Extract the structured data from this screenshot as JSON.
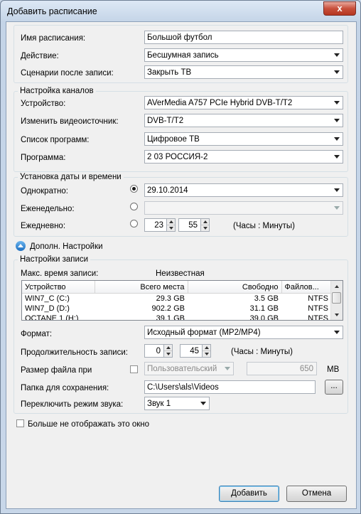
{
  "window": {
    "title": "Добавить расписание",
    "close_glyph": "x"
  },
  "schedule": {
    "name_label": "Имя расписания:",
    "name_value": "Большой футбол",
    "action_label": "Действие:",
    "action_value": "Бесшумная запись",
    "after_label": "Сценарии после записи:",
    "after_value": "Закрыть ТВ"
  },
  "channels": {
    "legend": "Настройка каналов",
    "device_label": "Устройство:",
    "device_value": "AVerMedia A757 PCIe Hybrid DVB-T/T2",
    "source_label": "Изменить видеоисточник:",
    "source_value": "DVB-T/T2",
    "list_label": "Список программ:",
    "list_value": "Цифровое ТВ",
    "program_label": "Программа:",
    "program_value": "2 03 РОССИЯ-2"
  },
  "datetime": {
    "legend": "Установка даты и времени",
    "once_label": "Однократно:",
    "once_value": "29.10.2014",
    "weekly_label": "Еженедельно:",
    "weekly_value": "",
    "daily_label": "Ежедневно:",
    "daily_hours": "23",
    "daily_minutes": "55",
    "time_hint": "(Часы : Минуты)"
  },
  "advanced": {
    "label": "Дополн. Настройки"
  },
  "recording": {
    "legend": "Настройки записи",
    "max_label": "Макс. время записи:",
    "max_value": "Неизвестная",
    "columns": [
      "Устройство",
      "Всего места",
      "Свободно",
      "Файлов..."
    ],
    "drives": [
      {
        "name": "WIN7_C (C:)",
        "total": "29.3 GB",
        "free": "3.5 GB",
        "fs": "NTFS"
      },
      {
        "name": "WIN7_D (D:)",
        "total": "902.2 GB",
        "free": "31.1 GB",
        "fs": "NTFS"
      },
      {
        "name": "OCTANE 1 (H:)",
        "total": "39.1 GB",
        "free": "39.0 GB",
        "fs": "NTFS"
      }
    ],
    "format_label": "Формат:",
    "format_value": "Исходный формат (MP2/MP4)",
    "duration_label": "Продолжительность записи:",
    "duration_hours": "0",
    "duration_minutes": "45",
    "duration_hint": "(Часы : Минуты)",
    "filesize_label": "Размер файла при",
    "filesize_mode": "Пользовательский",
    "filesize_value": "650",
    "filesize_unit": "MB",
    "folder_label": "Папка для сохранения:",
    "folder_value": "C:\\Users\\als\\Videos",
    "browse_label": "...",
    "sound_label": "Переключить режим звука:",
    "sound_value": "Звук 1"
  },
  "dont_show_label": "Больше не отображать это окно",
  "buttons": {
    "add": "Добавить",
    "cancel": "Отмена"
  }
}
